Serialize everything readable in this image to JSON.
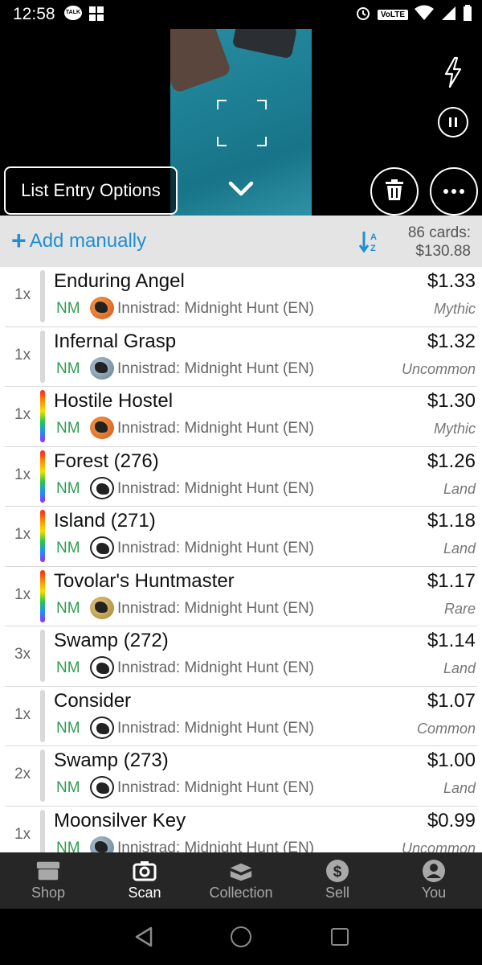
{
  "status_bar": {
    "time": "12:58",
    "talk_badge": "TALK",
    "volte_badge": "VoLTE"
  },
  "camera": {
    "list_entry_options_label": "List Entry Options"
  },
  "toolbar": {
    "add_manually_label": "Add manually",
    "card_count": "86 cards:",
    "total_value": "$130.88"
  },
  "cards": [
    {
      "qty": "1x",
      "name": "Enduring Angel",
      "condition": "NM",
      "set": "Innistrad: Midnight Hunt (EN)",
      "price": "$1.33",
      "rarity": "Mythic",
      "foil": false,
      "icon": "mythic"
    },
    {
      "qty": "1x",
      "name": "Infernal Grasp",
      "condition": "NM",
      "set": "Innistrad: Midnight Hunt (EN)",
      "price": "$1.32",
      "rarity": "Uncommon",
      "foil": false,
      "icon": "uncommon"
    },
    {
      "qty": "1x",
      "name": "Hostile Hostel",
      "condition": "NM",
      "set": "Innistrad: Midnight Hunt (EN)",
      "price": "$1.30",
      "rarity": "Mythic",
      "foil": true,
      "icon": "mythic"
    },
    {
      "qty": "1x",
      "name": "Forest (276)",
      "condition": "NM",
      "set": "Innistrad: Midnight Hunt (EN)",
      "price": "$1.26",
      "rarity": "Land",
      "foil": true,
      "icon": "common"
    },
    {
      "qty": "1x",
      "name": "Island (271)",
      "condition": "NM",
      "set": "Innistrad: Midnight Hunt (EN)",
      "price": "$1.18",
      "rarity": "Land",
      "foil": true,
      "icon": "common"
    },
    {
      "qty": "1x",
      "name": "Tovolar's Huntmaster",
      "condition": "NM",
      "set": "Innistrad: Midnight Hunt (EN)",
      "price": "$1.17",
      "rarity": "Rare",
      "foil": true,
      "icon": "rare"
    },
    {
      "qty": "3x",
      "name": "Swamp (272)",
      "condition": "NM",
      "set": "Innistrad: Midnight Hunt (EN)",
      "price": "$1.14",
      "rarity": "Land",
      "foil": false,
      "icon": "common"
    },
    {
      "qty": "1x",
      "name": "Consider",
      "condition": "NM",
      "set": "Innistrad: Midnight Hunt (EN)",
      "price": "$1.07",
      "rarity": "Common",
      "foil": false,
      "icon": "common"
    },
    {
      "qty": "2x",
      "name": "Swamp (273)",
      "condition": "NM",
      "set": "Innistrad: Midnight Hunt (EN)",
      "price": "$1.00",
      "rarity": "Land",
      "foil": false,
      "icon": "common"
    },
    {
      "qty": "1x",
      "name": "Moonsilver Key",
      "condition": "NM",
      "set": "Innistrad: Midnight Hunt (EN)",
      "price": "$0.99",
      "rarity": "Uncommon",
      "foil": false,
      "icon": "uncommon"
    }
  ],
  "bottom_nav": [
    {
      "label": "Shop",
      "icon": "shop-icon",
      "active": false
    },
    {
      "label": "Scan",
      "icon": "camera-icon",
      "active": true
    },
    {
      "label": "Collection",
      "icon": "collection-icon",
      "active": false
    },
    {
      "label": "Sell",
      "icon": "dollar-icon",
      "active": false
    },
    {
      "label": "You",
      "icon": "user-icon",
      "active": false
    }
  ],
  "colors": {
    "accent": "#1e8fd2",
    "condition_green": "#2e9c4f",
    "nav_background": "#262626"
  }
}
